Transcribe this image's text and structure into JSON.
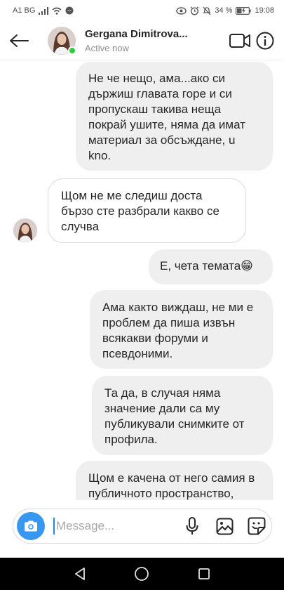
{
  "status_bar": {
    "carrier": "A1 BG",
    "battery": "34 %",
    "time": "19:08"
  },
  "header": {
    "contact_name": "Gergana Dimitrova...",
    "contact_status": "Active now"
  },
  "messages": [
    {
      "direction": "sent",
      "text": "Не че нещо, ама...ако си държиш главата горе и си пропускаш такива неща покрай ушите, няма да имат материал за обсъждане, u kno."
    },
    {
      "direction": "received",
      "text": "Щом не ме следиш доста бързо сте разбрали какво се случва"
    },
    {
      "direction": "sent",
      "text": "Е, чета темата😁"
    },
    {
      "direction": "sent",
      "text": "Ама както виждаш, не ми е проблем да пиша извън всякакви форуми и псевдоними."
    },
    {
      "direction": "sent",
      "text": "Та да, в случая няма значение дали са му публикували снимките от профила."
    },
    {
      "direction": "sent",
      "text": "Щом е качена от него самия в публичното пространство,"
    }
  ],
  "composer": {
    "placeholder": "Message..."
  }
}
